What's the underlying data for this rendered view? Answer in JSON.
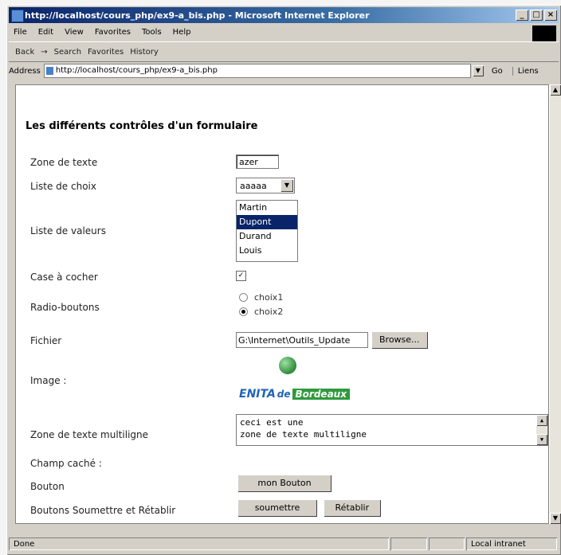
{
  "window": {
    "title": "http://localhost/cours_php/ex9-a_bis.php - Microsoft Internet Explorer",
    "min_label": "_",
    "max_label": "□",
    "close_label": "×"
  },
  "menu": [
    "File",
    "Edit",
    "View",
    "Favorites",
    "Tools",
    "Help"
  ],
  "toolbar": {
    "back": "Back",
    "forward": "→",
    "search": "Search",
    "favorites": "Favorites",
    "history": "History"
  },
  "address": {
    "label": "Address",
    "value": "http://localhost/cours_php/ex9-a_bis.php",
    "go": "Go",
    "links": "Liens"
  },
  "form": {
    "heading": "Les différents contrôles d'un formulaire",
    "labels": {
      "zone_texte": "Zone de texte",
      "liste_choix": "Liste de choix",
      "liste_valeurs": "Liste de valeurs",
      "case_cocher": "Case à cocher",
      "radio_boutons": "Radio-boutons",
      "fichier": "Fichier",
      "image": "Image :",
      "zone_multiligne": "Zone de texte multiligne",
      "champ_cache": "Champ caché :",
      "bouton": "Bouton",
      "soumettre_retablir": "Boutons Soumettre et Rétablir"
    },
    "text_value": "azer",
    "select_value": "aaaaa",
    "list_values": [
      "Martin",
      "Dupont",
      "Durand",
      "Louis"
    ],
    "list_selected": "Dupont",
    "checkbox_checked": "✓",
    "radio": [
      {
        "label": "choix1",
        "checked": false
      },
      {
        "label": "choix2",
        "checked": true
      }
    ],
    "file_path": "G:\\Internet\\Outils_Update",
    "browse_label": "Browse...",
    "image_text": {
      "part1": "ENITA",
      "part2": "de",
      "part3": "Bordeaux"
    },
    "textarea_lines": [
      "ceci est une",
      "zone de texte multiligne"
    ],
    "mon_bouton_label": "mon Bouton",
    "submit_label": "soumettre",
    "reset_label": "Rétablir"
  },
  "status": {
    "left": "Done",
    "zone": "Local intranet"
  }
}
